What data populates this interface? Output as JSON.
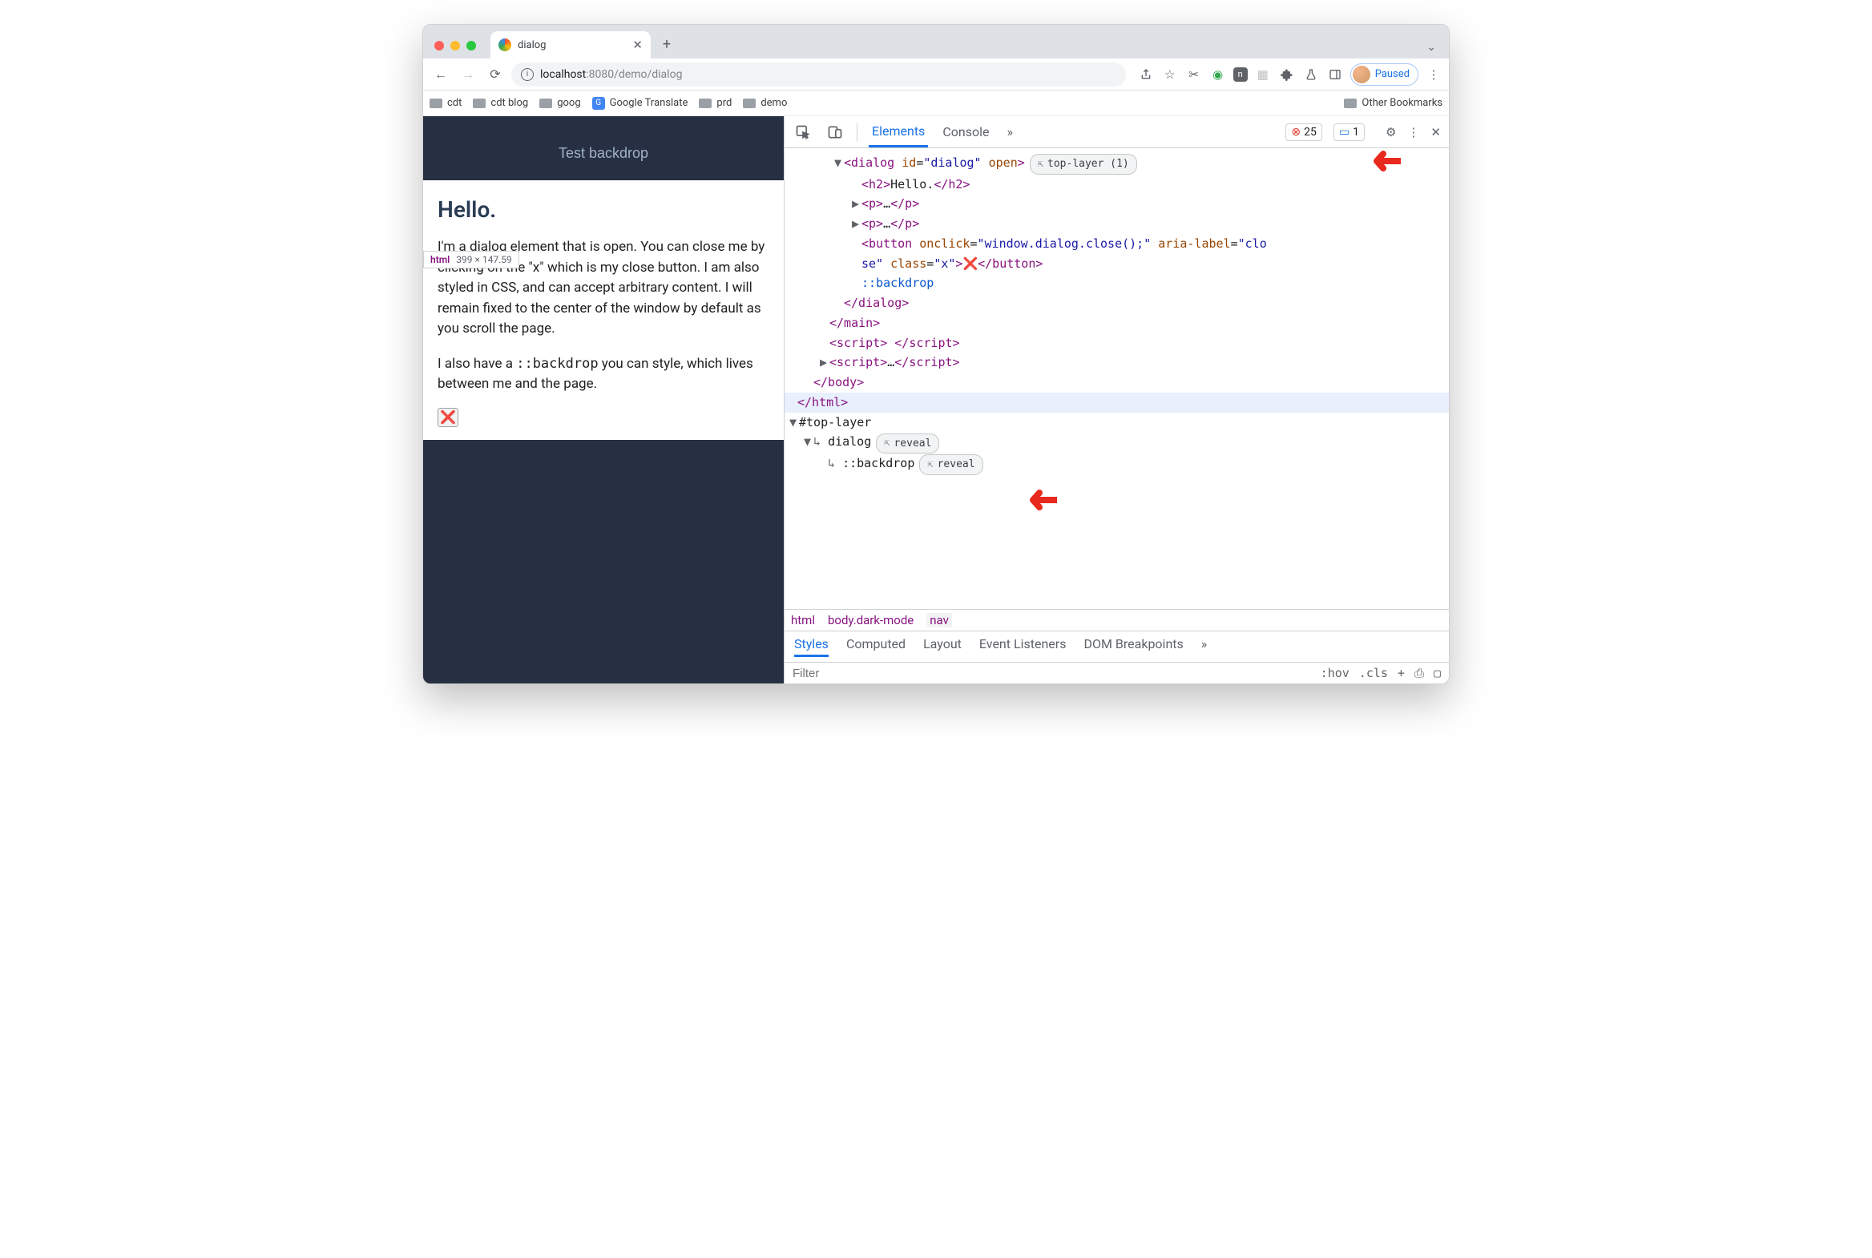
{
  "tab": {
    "title": "dialog"
  },
  "url": {
    "host": "localhost",
    "port": ":8080",
    "path": "/demo/dialog"
  },
  "profile": {
    "paused_label": "Paused"
  },
  "bookmarks": {
    "items": [
      "cdt",
      "cdt blog",
      "goog",
      "Google Translate",
      "prd",
      "demo"
    ],
    "other": "Other Bookmarks"
  },
  "page": {
    "test_button": "Test backdrop",
    "dialog_title": "Hello.",
    "tooltip_label": "html",
    "tooltip_dims": "399 × 147.59",
    "p1": "I'm a dialog element that is open. You can close me by clicking on the \"x\" which is my close button. I am also styled in CSS, and can accept arbitrary content. I will remain fixed to the center of the window by default as you scroll the page.",
    "p2_pre": "I also have a ",
    "p2_code": "::backdrop",
    "p2_post": " you can style, which lives between me and the page.",
    "x_glyph": "❌"
  },
  "devtools": {
    "tabs": {
      "elements": "Elements",
      "console": "Console",
      "more": "»"
    },
    "counts": {
      "errors": "25",
      "info": "1"
    },
    "tree": {
      "dialog_open": "<dialog id=\"dialog\" open>",
      "top_layer_badge": "top-layer (1)",
      "h2": "<h2>Hello.</h2>",
      "p_collapsed": "<p>…</p>",
      "button_line1": "<button onclick=\"window.dialog.close();\" aria-label=\"clo",
      "button_line2": "se\" class=\"x\">❌</button>",
      "backdrop": "::backdrop",
      "dialog_close": "</dialog>",
      "main_close": "</main>",
      "script_empty": "<script> </script>",
      "script_collapsed": "<script>…</script>",
      "body_close": "</body>",
      "html_close": "</html>",
      "top_layer_root": "#top-layer",
      "tl_dialog": "dialog",
      "tl_backdrop": "::backdrop",
      "reveal": "reveal"
    },
    "crumbs": [
      "html",
      "body.dark-mode",
      "nav"
    ],
    "styles_tabs": [
      "Styles",
      "Computed",
      "Layout",
      "Event Listeners",
      "DOM Breakpoints",
      "»"
    ],
    "filter": {
      "placeholder": "Filter",
      "hov": ":hov",
      "cls": ".cls"
    }
  }
}
